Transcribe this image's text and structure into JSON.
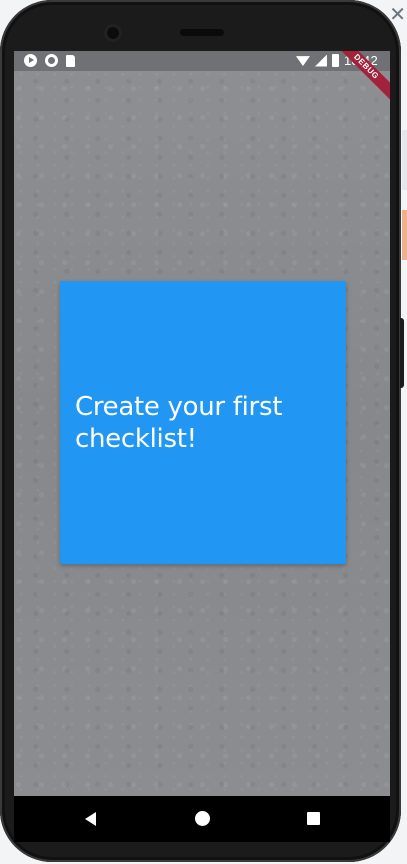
{
  "status_bar": {
    "time": "18:42",
    "left_icons": [
      "play-store-icon",
      "circle-icon",
      "sd-card-icon"
    ],
    "right_icons": [
      "wifi-icon",
      "signal-icon",
      "battery-icon"
    ]
  },
  "debug_banner": {
    "label": "DEBUG"
  },
  "card": {
    "message": "Create your first checklist!",
    "color": "#2196f3"
  },
  "nav_bar": {
    "buttons": [
      "back",
      "home",
      "recents"
    ]
  },
  "host": {
    "close_glyph": "✕"
  }
}
